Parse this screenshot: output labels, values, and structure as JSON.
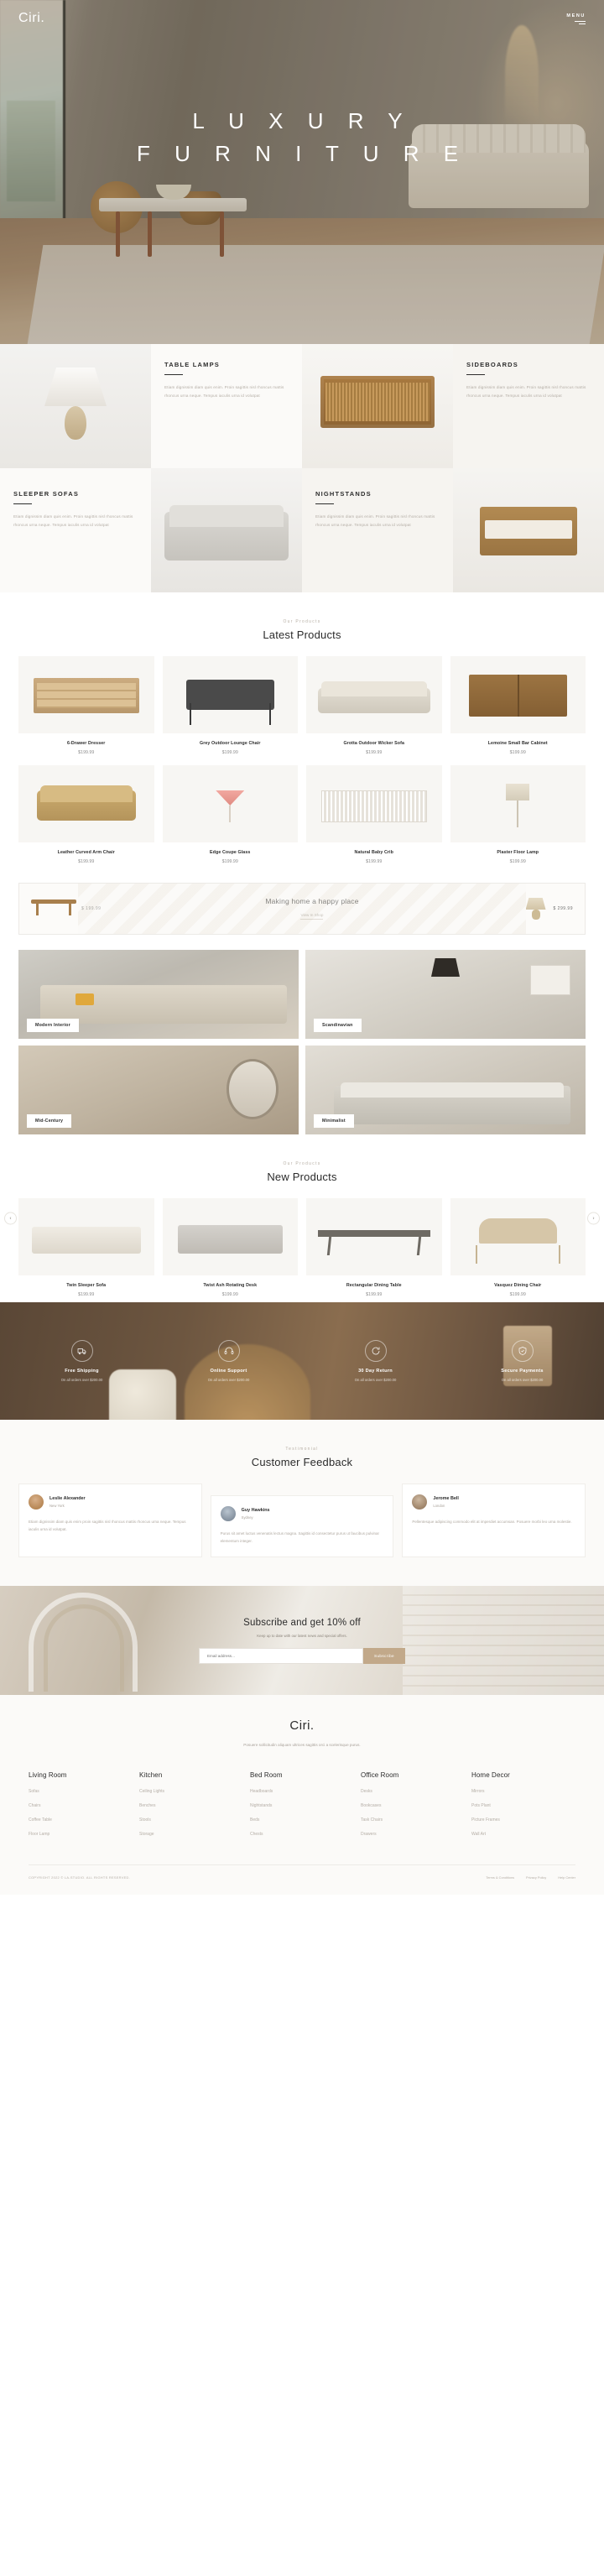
{
  "header": {
    "brand": "Ciri.",
    "menu_label": "MENU"
  },
  "hero": {
    "title_line1": "L U X U R Y",
    "title_line2": "F U R N I T U R E"
  },
  "categories": [
    {
      "title": "TABLE LAMPS",
      "desc": "Etiam dignissim diam quis enim. Proin sagittis nisl rhoncus mattis rhoncus urna neque. Tempus iaculis urna id volutpat"
    },
    {
      "title": "SIDEBOARDS",
      "desc": "Etiam dignissim diam quis enim. Proin sagittis nisl rhoncus mattis rhoncus urna neque. Tempus iaculis urna id volutpat"
    },
    {
      "title": "SLEEPER SOFAS",
      "desc": "Etiam dignissim diam quis enim. Proin sagittis nisl rhoncus mattis rhoncus urna neque. Tempus iaculis urna id volutpat"
    },
    {
      "title": "NIGHTSTANDS",
      "desc": "Etiam dignissim diam quis enim. Proin sagittis nisl rhoncus mattis rhoncus urna neque. Tempus iaculis urna id volutpat"
    }
  ],
  "latest": {
    "kicker": "Our Products",
    "title": "Latest Products",
    "items": [
      {
        "name": "6-Drawer Dresser",
        "price": "$199.99"
      },
      {
        "name": "Grey Outdoor Lounge Chair",
        "price": "$199.99"
      },
      {
        "name": "Grotta Outdoor Wicker Sofa",
        "price": "$199.99"
      },
      {
        "name": "Lemoine Small Bar Cabinet",
        "price": "$199.99"
      },
      {
        "name": "Leather Curved Arm Chair",
        "price": "$199.99"
      },
      {
        "name": "Edge Coupe Glass",
        "price": "$199.99"
      },
      {
        "name": "Natural Baby Crib",
        "price": "$199.99"
      },
      {
        "name": "Plaster Floor Lamp",
        "price": "$199.99"
      }
    ]
  },
  "promo": {
    "left_price": "$ 199.99",
    "headline": "Making home a happy place",
    "link": "View In Shop",
    "right_price": "$ 299.99"
  },
  "rooms": [
    {
      "tag": "Modern Interior"
    },
    {
      "tag": "Scandinavian"
    },
    {
      "tag": "Mid-Century"
    },
    {
      "tag": "Minimalist"
    }
  ],
  "newproducts": {
    "kicker": "Our Products",
    "title": "New Products",
    "prev_icon": "chevron-left-icon",
    "next_icon": "chevron-right-icon",
    "items": [
      {
        "name": "Twin Sleeper Sofa",
        "price": "$199.99"
      },
      {
        "name": "Twist Ash Rotating Desk",
        "price": "$199.99"
      },
      {
        "name": "Rectangular Dining Table",
        "price": "$199.99"
      },
      {
        "name": "Vasquez Dining Chair",
        "price": "$199.99"
      }
    ]
  },
  "features": [
    {
      "icon": "truck-icon",
      "title": "Free Shipping",
      "sub": "On all orders over $200.00"
    },
    {
      "icon": "headset-icon",
      "title": "Online Support",
      "sub": "On all orders over $200.00"
    },
    {
      "icon": "refresh-icon",
      "title": "30 Day Return",
      "sub": "On all orders over $200.00"
    },
    {
      "icon": "shield-icon",
      "title": "Secure Payments",
      "sub": "On all orders over $200.00"
    }
  ],
  "testimonials": {
    "kicker": "Testimonial",
    "title": "Customer Feedback",
    "items": [
      {
        "name": "Leslie Alexander",
        "role": "New York",
        "text": "Etiam dignissim diam quis enim proin sagittis nisl rhoncus mattis rhoncus urna neque. Tempus iaculis urna id volutpat."
      },
      {
        "name": "Guy Hawkins",
        "role": "Sydney",
        "text": "Purus sit amet luctus venenatis lectus magna. Sagittis id consectetur purus ut faucibus pulvinar elementum integer."
      },
      {
        "name": "Jerome Bell",
        "role": "London",
        "text": "Pellentesque adipiscing commodo elit at imperdiet accumsan. Posuere morbi leo urna molestie."
      }
    ]
  },
  "newsletter": {
    "title": "Subscribe and get 10% off",
    "subtitle": "Keep up to date with our latest news and special offers.",
    "placeholder": "Email address...",
    "button": "Subscribe"
  },
  "footer": {
    "brand": "Ciri.",
    "tagline": "Posuere sollicitudin aliquam ultrices sagittis orci a scelerisque purus.",
    "columns": [
      {
        "heading": "Living Room",
        "links": [
          "Sofas",
          "Chairs",
          "Coffee Table",
          "Floor Lamp"
        ]
      },
      {
        "heading": "Kitchen",
        "links": [
          "Ceiling Lights",
          "Benches",
          "Stools",
          "Storage"
        ]
      },
      {
        "heading": "Bed Room",
        "links": [
          "Headboards",
          "Nightstands",
          "Beds",
          "Chests"
        ]
      },
      {
        "heading": "Office Room",
        "links": [
          "Desks",
          "Bookcases",
          "Task Chairs",
          "Drawers"
        ]
      },
      {
        "heading": "Home Decor",
        "links": [
          "Mirrors",
          "Pots Plant",
          "Picture Frames",
          "Wall Art"
        ]
      }
    ],
    "copyright": "COPYRIGHT 2022 © LA-STUDIO. ALL RIGHTS RESERVED.",
    "bottom_links": [
      "Terms & Conditions",
      "Privacy Policy",
      "Help Center"
    ]
  },
  "colors": {
    "accent": "#c2a98a",
    "dark": "#2b2b2b",
    "muted": "#b5aea6",
    "surface": "#fbfaf8"
  }
}
